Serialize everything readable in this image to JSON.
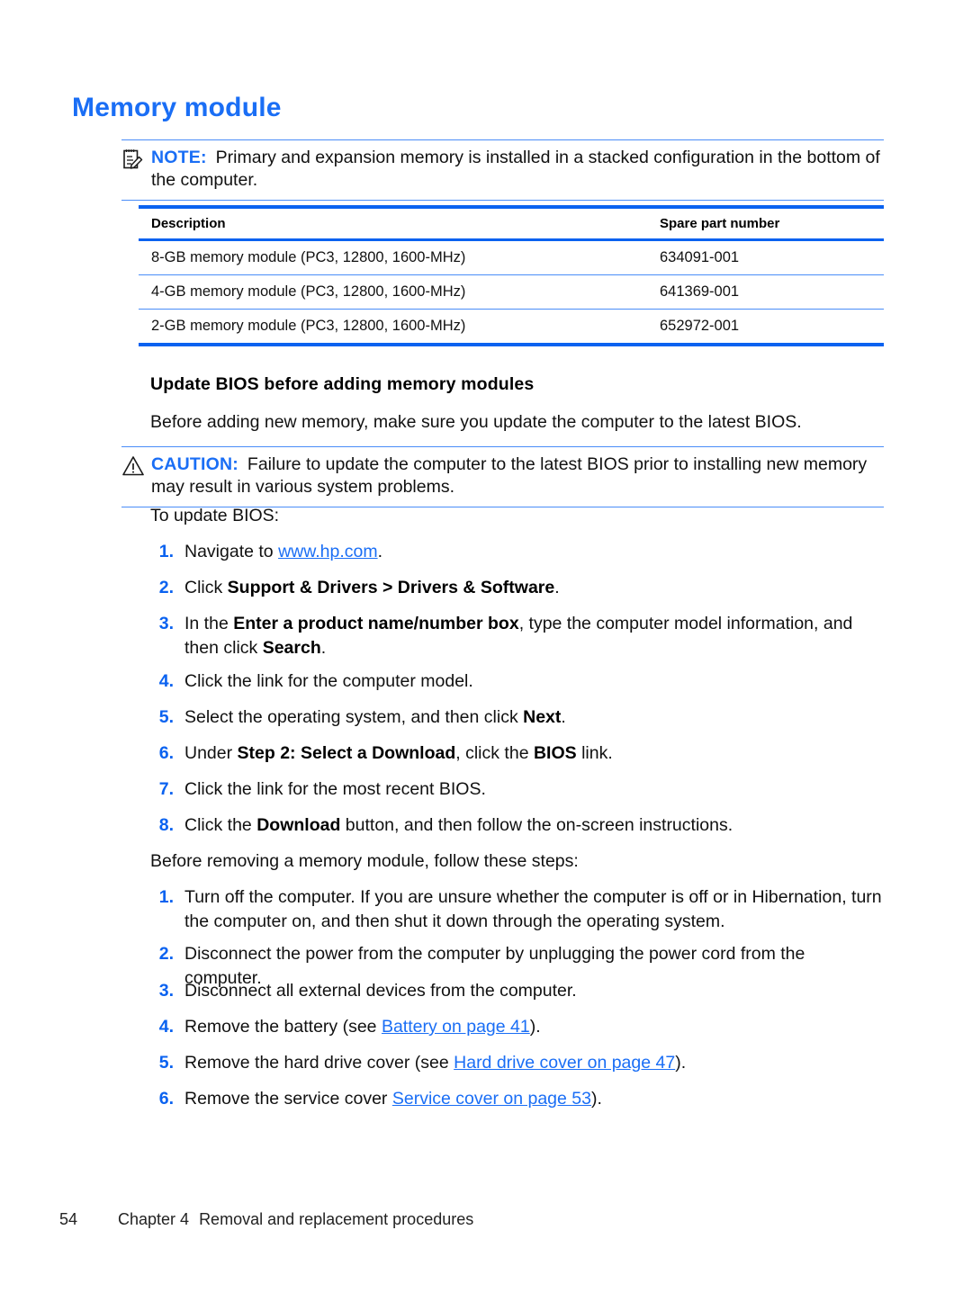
{
  "title": "Memory module",
  "note": {
    "icon": "note-pad-pencil-icon",
    "label": "NOTE:",
    "text": "Primary and expansion memory is installed in a stacked configuration in the bottom of the computer."
  },
  "table": {
    "headers": [
      "Description",
      "Spare part number"
    ],
    "rows": [
      {
        "description": "8-GB memory module (PC3, 12800, 1600-MHz)",
        "part": "634091-001"
      },
      {
        "description": "4-GB memory module (PC3, 12800, 1600-MHz)",
        "part": "641369-001"
      },
      {
        "description": "2-GB memory module (PC3, 12800, 1600-MHz)",
        "part": "652972-001"
      }
    ]
  },
  "bios_section": {
    "heading": "Update BIOS before adding memory modules",
    "intro": "Before adding new memory, make sure you update the computer to the latest BIOS.",
    "caution": {
      "icon": "warning-triangle-icon",
      "label": "CAUTION:",
      "text": "Failure to update the computer to the latest BIOS prior to installing new memory may result in various system problems."
    },
    "list_intro": "To update BIOS:",
    "steps": [
      {
        "num": "1.",
        "pre": "Navigate to ",
        "link": "www.hp.com",
        "post": "."
      },
      {
        "num": "2.",
        "pre": "Click ",
        "bold1": "Support & Drivers > Drivers & Software",
        "post": "."
      },
      {
        "num": "3.",
        "pre": "In the ",
        "bold1": "Enter a product name/number box",
        "mid": ", type the computer model information, and then click ",
        "bold2": "Search",
        "post": "."
      },
      {
        "num": "4.",
        "pre": "Click the link for the computer model."
      },
      {
        "num": "5.",
        "pre": "Select the operating system, and then click ",
        "bold1": "Next",
        "post": "."
      },
      {
        "num": "6.",
        "pre": "Under ",
        "bold1": "Step 2: Select a Download",
        "mid": ", click the ",
        "bold2": "BIOS",
        "post": " link."
      },
      {
        "num": "7.",
        "pre": "Click the link for the most recent BIOS."
      },
      {
        "num": "8.",
        "pre": "Click the ",
        "bold1": "Download",
        "post": " button, and then follow the on-screen instructions."
      }
    ]
  },
  "removal_section": {
    "intro": "Before removing a memory module, follow these steps:",
    "steps": [
      {
        "num": "1.",
        "pre": "Turn off the computer. If you are unsure whether the computer is off or in Hibernation, turn the computer on, and then shut it down through the operating system."
      },
      {
        "num": "2.",
        "pre": "Disconnect the power from the computer by unplugging the power cord from the computer."
      },
      {
        "num": "3.",
        "pre": "Disconnect all external devices from the computer."
      },
      {
        "num": "4.",
        "pre": "Remove the battery (see ",
        "link": "Battery on page 41",
        "post": ")."
      },
      {
        "num": "5.",
        "pre": "Remove the hard drive cover (see ",
        "link": "Hard drive cover on page 47",
        "post": ")."
      },
      {
        "num": "6.",
        "pre": "Remove the service cover ",
        "link": "Service cover on page 53",
        "post": ")."
      }
    ]
  },
  "footer": {
    "page_number": "54",
    "chapter": "Chapter 4",
    "chapter_title": "Removal and replacement procedures"
  },
  "colors": {
    "title_blue": "#1a6ef5",
    "rule_blue": "#4a8df8",
    "table_border_blue": "#0a62f0",
    "link_blue": "#1a6ef5"
  }
}
